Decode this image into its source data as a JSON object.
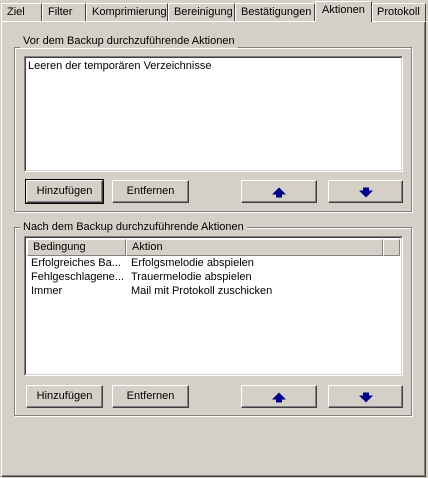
{
  "tabs": [
    {
      "label": "Ziel"
    },
    {
      "label": "Filter"
    },
    {
      "label": "Komprimierung"
    },
    {
      "label": "Bereinigung"
    },
    {
      "label": "Bestätigungen"
    },
    {
      "label": "Aktionen"
    },
    {
      "label": "Protokoll"
    }
  ],
  "active_tab": "Aktionen",
  "pre_backup": {
    "title": "Vor dem Backup durchzuführende Aktionen",
    "items": [
      "Leeren der temporären Verzeichnisse"
    ],
    "add_label": "Hinzufügen",
    "remove_label": "Entfernen"
  },
  "post_backup": {
    "title": "Nach dem Backup durchzuführende Aktionen",
    "columns": [
      "Bedingung",
      "Aktion"
    ],
    "rows": [
      {
        "condition": "Erfolgreiches Ba...",
        "action": "Erfolgsmelodie abspielen"
      },
      {
        "condition": "Fehlgeschlagene...",
        "action": "Trauermelodie abspielen"
      },
      {
        "condition": "Immer",
        "action": "Mail mit Protokoll zuschicken"
      }
    ],
    "add_label": "Hinzufügen",
    "remove_label": "Entfernen"
  },
  "colors": {
    "face": "#d4d0c8",
    "arrow": "#00008b"
  }
}
